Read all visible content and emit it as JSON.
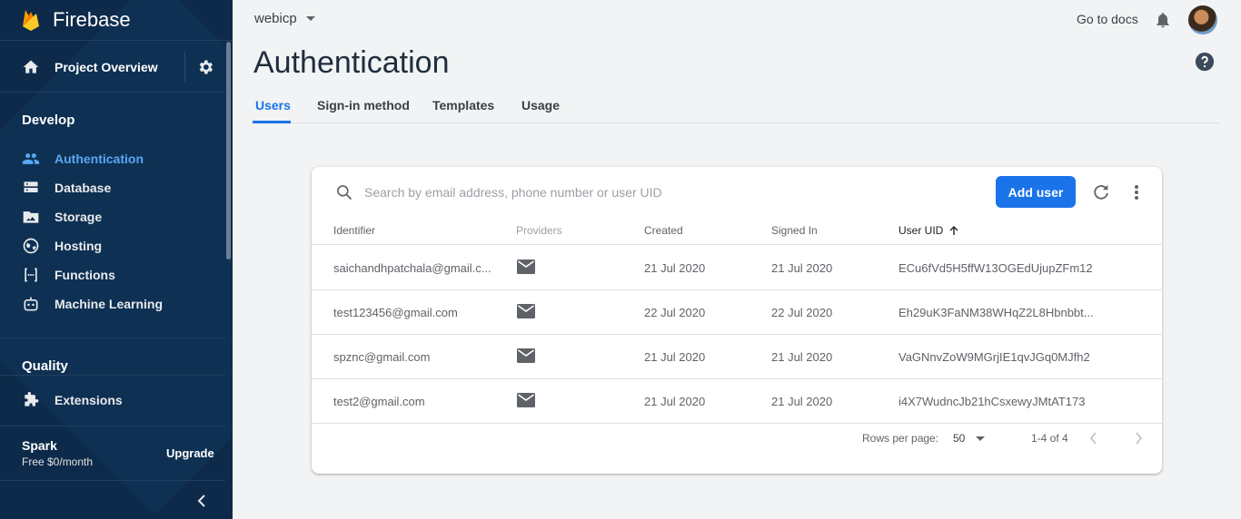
{
  "colors": {
    "sidebar_bg": "#0d2a4a",
    "accent": "#1a73e8",
    "active_nav": "#5aa7f4"
  },
  "brand": {
    "name": "Firebase",
    "icon": "firebase-flame-icon"
  },
  "sidebar": {
    "project_overview": "Project Overview",
    "sections": {
      "develop": "Develop",
      "quality": "Quality"
    },
    "develop_items": [
      {
        "label": "Authentication",
        "icon": "people-icon",
        "active": true
      },
      {
        "label": "Database",
        "icon": "database-icon"
      },
      {
        "label": "Storage",
        "icon": "storage-icon"
      },
      {
        "label": "Hosting",
        "icon": "globe-icon"
      },
      {
        "label": "Functions",
        "icon": "functions-icon"
      },
      {
        "label": "Machine Learning",
        "icon": "robot-icon"
      }
    ],
    "extensions": "Extensions",
    "plan": {
      "name": "Spark",
      "price": "Free $0/month",
      "upgrade": "Upgrade"
    }
  },
  "header": {
    "project": "webicp",
    "docs": "Go to docs",
    "title": "Authentication"
  },
  "tabs": [
    "Users",
    "Sign-in method",
    "Templates",
    "Usage"
  ],
  "users": {
    "search_placeholder": "Search by email address, phone number or user UID",
    "add_user": "Add user",
    "columns": {
      "identifier": "Identifier",
      "providers": "Providers",
      "created": "Created",
      "signed_in": "Signed In",
      "uid": "User UID"
    },
    "rows": [
      {
        "identifier": "saichandhpatchala@gmail.c...",
        "provider": "email-icon",
        "created": "21 Jul 2020",
        "signed_in": "21 Jul 2020",
        "uid": "ECu6fVd5H5ffW13OGEdUjupZFm12"
      },
      {
        "identifier": "test123456@gmail.com",
        "provider": "email-icon",
        "created": "22 Jul 2020",
        "signed_in": "22 Jul 2020",
        "uid": "Eh29uK3FaNM38WHqZ2L8Hbnbbt..."
      },
      {
        "identifier": "spznc@gmail.com",
        "provider": "email-icon",
        "created": "21 Jul 2020",
        "signed_in": "21 Jul 2020",
        "uid": "VaGNnvZoW9MGrjIE1qvJGq0MJfh2"
      },
      {
        "identifier": "test2@gmail.com",
        "provider": "email-icon",
        "created": "21 Jul 2020",
        "signed_in": "21 Jul 2020",
        "uid": "i4X7WudncJb21hCsxewyJMtAT173"
      }
    ],
    "pagination": {
      "rows_per_page_label": "Rows per page:",
      "rows_per_page": "50",
      "range": "1-4 of 4"
    }
  }
}
